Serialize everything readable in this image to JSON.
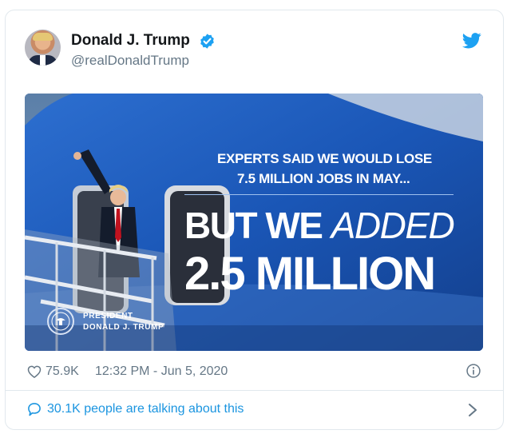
{
  "author": {
    "display_name": "Donald J. Trump",
    "handle": "@realDonaldTrump",
    "verified": true
  },
  "image": {
    "line1": "EXPERTS SAID WE WOULD LOSE",
    "line2": "7.5 MILLION JOBS IN MAY...",
    "big_bold": "BUT WE ",
    "big_light": "ADDED",
    "big_number": "2.5 MILLION",
    "seal_line1": "PRESIDENT",
    "seal_line2": "DONALD J. TRUMP"
  },
  "footer": {
    "likes": "75.9K",
    "timestamp": "12:32 PM - Jun 5, 2020",
    "talking": "30.1K people are talking about this"
  },
  "icons": {
    "brand": "twitter-bird-icon",
    "verified": "verified-badge-icon",
    "like": "heart-icon",
    "info": "info-icon",
    "reply": "speech-bubble-icon",
    "more": "chevron-right-icon"
  },
  "colors": {
    "twitter_blue": "#1da1f2",
    "link_blue": "#1b95e0",
    "muted_text": "#657786",
    "border": "#e1e8ed"
  }
}
